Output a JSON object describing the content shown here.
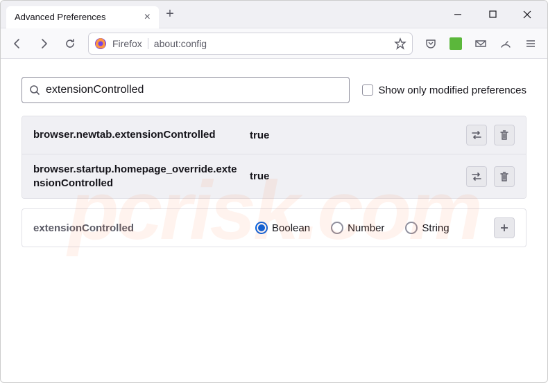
{
  "window": {
    "tab_title": "Advanced Preferences",
    "url_prefix": "Firefox",
    "url": "about:config"
  },
  "search": {
    "value": "extensionControlled",
    "modified_only_label": "Show only modified preferences"
  },
  "prefs": [
    {
      "name": "browser.newtab.extensionControlled",
      "value": "true"
    },
    {
      "name": "browser.startup.homepage_override.extensionControlled",
      "value": "true"
    }
  ],
  "new_pref": {
    "name": "extensionControlled",
    "types": [
      "Boolean",
      "Number",
      "String"
    ],
    "selected": "Boolean"
  },
  "watermark": "pcrisk.com"
}
